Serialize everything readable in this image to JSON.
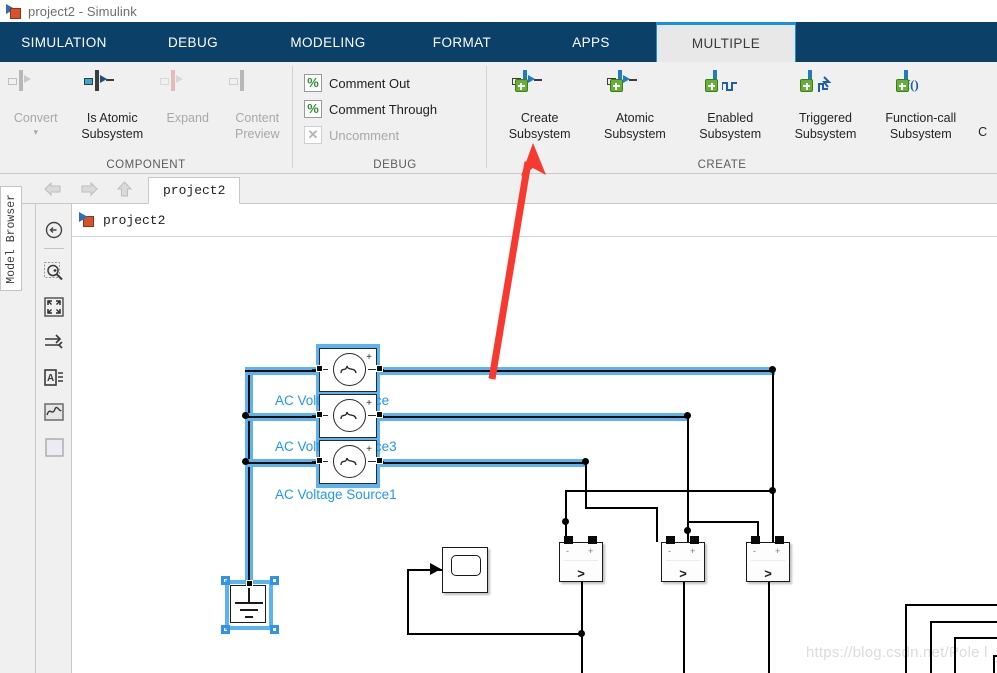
{
  "window": {
    "title": "project2 - Simulink",
    "app_icon": "simulink-model-icon"
  },
  "ribbon_tabs": [
    {
      "label": "SIMULATION",
      "active": false
    },
    {
      "label": "DEBUG",
      "active": false
    },
    {
      "label": "MODELING",
      "active": false
    },
    {
      "label": "FORMAT",
      "active": false
    },
    {
      "label": "APPS",
      "active": false
    },
    {
      "label": "MULTIPLE",
      "active": true
    }
  ],
  "ribbon": {
    "groups": [
      {
        "title": "COMPONENT",
        "buttons": [
          {
            "label_line1": "Convert",
            "label_line2": "▾",
            "icon": "convert-icon",
            "disabled": true
          },
          {
            "label_line1": "Is Atomic",
            "label_line2": "Subsystem",
            "icon": "is-atomic-subsystem-icon",
            "disabled": false
          },
          {
            "label_line1": "Expand",
            "label_line2": "",
            "icon": "expand-icon",
            "disabled": true
          },
          {
            "label_line1": "Content",
            "label_line2": "Preview",
            "icon": "content-preview-icon",
            "disabled": true
          }
        ]
      },
      {
        "title": "DEBUG",
        "commands": [
          {
            "label": "Comment Out",
            "icon": "percent-comment-out-icon",
            "disabled": false
          },
          {
            "label": "Comment Through",
            "icon": "percent-comment-through-icon",
            "disabled": false
          },
          {
            "label": "Uncomment",
            "icon": "uncomment-icon",
            "disabled": true
          }
        ]
      },
      {
        "title": "CREATE",
        "buttons": [
          {
            "label_line1": "Create",
            "label_line2": "Subsystem",
            "icon": "create-subsystem-icon",
            "disabled": false
          },
          {
            "label_line1": "Atomic",
            "label_line2": "Subsystem",
            "icon": "atomic-subsystem-icon",
            "disabled": false
          },
          {
            "label_line1": "Enabled",
            "label_line2": "Subsystem",
            "icon": "enabled-subsystem-icon",
            "disabled": false
          },
          {
            "label_line1": "Triggered",
            "label_line2": "Subsystem",
            "icon": "triggered-subsystem-icon",
            "disabled": false
          },
          {
            "label_line1": "Function-call",
            "label_line2": "Subsystem",
            "icon": "function-call-subsystem-icon",
            "disabled": false
          },
          {
            "label_line1": "C",
            "label_line2": "",
            "icon": "clipped-subsystem-icon",
            "disabled": false
          }
        ]
      }
    ]
  },
  "navbar": {
    "back_icon": "back-arrow-icon",
    "forward_icon": "forward-arrow-icon",
    "up_icon": "up-arrow-icon",
    "breadcrumb_tab": "project2"
  },
  "model_browser": {
    "label": "Model Browser"
  },
  "canvas_toolbar": {
    "items": [
      {
        "name": "navigate-back-icon",
        "label": "back"
      },
      {
        "name": "zoom-in-icon",
        "label": "zoom"
      },
      {
        "name": "fit-to-view-icon",
        "label": "fit"
      },
      {
        "name": "signal-routing-icon",
        "label": "routing"
      },
      {
        "name": "annotation-icon",
        "label": "annotation"
      },
      {
        "name": "scope-viewer-icon",
        "label": "viewer"
      },
      {
        "name": "blank-area-icon",
        "label": "blank"
      }
    ]
  },
  "canvas": {
    "header_label": "project2",
    "header_icon": "simulink-model-icon",
    "watermark": "https://blog.csdn.net/Pole  l",
    "blocks": [
      {
        "name": "ac-voltage-source-0",
        "label": "AC Voltage Source",
        "type": "ac-voltage-source",
        "selected": true
      },
      {
        "name": "ac-voltage-source-3",
        "label": "AC Voltage Source3",
        "type": "ac-voltage-source",
        "selected": true
      },
      {
        "name": "ac-voltage-source-1",
        "label": "AC Voltage Source1",
        "type": "ac-voltage-source",
        "selected": true
      },
      {
        "name": "ground-block",
        "label": "",
        "type": "ground",
        "selected": true
      },
      {
        "name": "scope-block",
        "label": "",
        "type": "scope",
        "selected": false
      },
      {
        "name": "voltage-measurement-1",
        "label": "",
        "type": "voltage-measurement",
        "selected": false
      },
      {
        "name": "voltage-measurement-2",
        "label": "",
        "type": "voltage-measurement",
        "selected": false
      },
      {
        "name": "voltage-measurement-3",
        "label": "",
        "type": "voltage-measurement",
        "selected": false
      }
    ],
    "voltage_measurement": {
      "minus": "-",
      "plus": "+",
      "gt": ">"
    }
  },
  "annotation": {
    "arrow_color": "#f8392f",
    "points_to": "Create Subsystem"
  },
  "colors": {
    "ribbon_blue": "#0b4069",
    "tab_active_bg": "#e8e8e8",
    "tab_accent": "#1a8fe0",
    "selection_blue": "#5cb3ef",
    "label_blue": "#2196f3",
    "annotation_red": "#f8392f"
  }
}
